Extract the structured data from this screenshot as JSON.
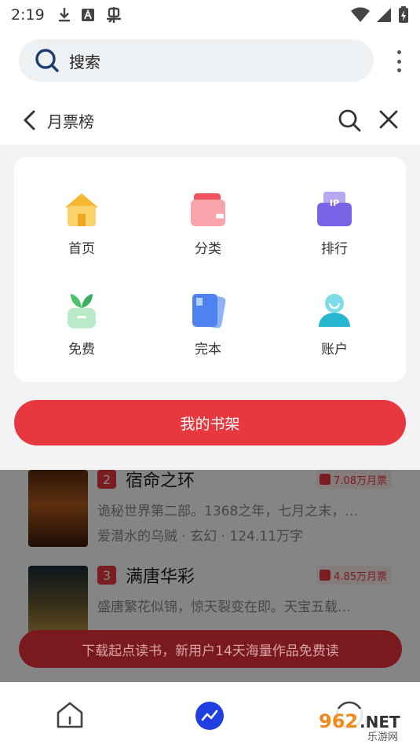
{
  "status_bar": {
    "time": "2:19",
    "icons_left": [
      "download-icon",
      "a-box-icon",
      "bug-icon"
    ],
    "icons_right": [
      "wifi-icon",
      "signal-icon",
      "battery-icon"
    ]
  },
  "browser": {
    "search_label": "搜索",
    "menu_icon": "kebab-icon"
  },
  "page_header": {
    "title": "月票榜"
  },
  "menu": {
    "items": [
      {
        "label": "首页",
        "icon": "home-icon",
        "color": "#f6b733"
      },
      {
        "label": "分类",
        "icon": "category-icon",
        "color": "#ee5561"
      },
      {
        "label": "排行",
        "icon": "ranking-icon",
        "color": "#7a63e6",
        "badge": "IP"
      },
      {
        "label": "免费",
        "icon": "free-icon",
        "color": "#49c26d"
      },
      {
        "label": "完本",
        "icon": "finished-icon",
        "color": "#4d82f0"
      },
      {
        "label": "账户",
        "icon": "account-icon",
        "color": "#27b6cf"
      }
    ],
    "shelf_button": "我的书架"
  },
  "books": [
    {
      "rank": "2",
      "title": "宿命之环",
      "votes": "7.08万月票",
      "desc": "诡秘世界第二部。1368之年，七月之末，…",
      "meta": "爱潜水的乌贼 · 玄幻 · 124.11万字"
    },
    {
      "rank": "3",
      "title": "满唐华彩",
      "votes": "4.85万月票",
      "desc": "盛唐繁花似锦，惊天裂变在即。天宝五载…",
      "meta": ""
    }
  ],
  "download_banner": "下载起点读书，新用户14天海量作品免费读",
  "bottom_nav": [
    "home-icon",
    "trend-icon",
    "profile-icon"
  ],
  "watermark": {
    "brand": "962.NET",
    "sub": "乐游网"
  },
  "colors": {
    "accent": "#e8383f",
    "nav_active": "#1f3fe0"
  }
}
